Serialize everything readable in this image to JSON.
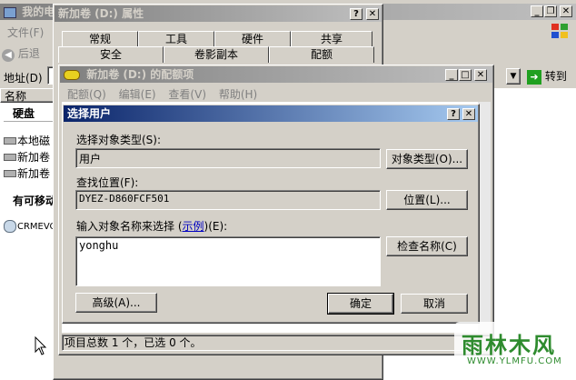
{
  "explorer": {
    "title": "我的电",
    "menu_file": "文件(F)",
    "back": "后退",
    "address_label": "地址(D)",
    "go_label": "转到",
    "column_name": "名称",
    "section_disks": "硬盘",
    "drives": [
      "本地磁",
      "新加卷",
      "新加卷"
    ],
    "section_removable": "有可移动",
    "cd_drive": "CRMEVO"
  },
  "properties": {
    "title": "新加卷 (D:) 属性",
    "tabs_row1": [
      "常规",
      "工具",
      "硬件",
      "共享"
    ],
    "tabs_row2": [
      "安全",
      "卷影副本",
      "配额"
    ]
  },
  "quota": {
    "title": "新加卷 (D:) 的配额项",
    "menu": [
      "配额(Q)",
      "编辑(E)",
      "查看(V)",
      "帮助(H)"
    ],
    "status": "项目总数 1 个，已选 0 个。"
  },
  "select_user": {
    "title": "选择用户",
    "object_type_label": "选择对象类型(S):",
    "object_type_value": "用户",
    "object_type_button": "对象类型(O)...",
    "location_label": "查找位置(F):",
    "location_value": "DYEZ-D860FCF501",
    "location_button": "位置(L)...",
    "names_label_pre": "输入对象名称来选择 (",
    "names_label_link": "示例",
    "names_label_post": ")(E):",
    "names_value": "yonghu",
    "check_names_button": "检查名称(C)",
    "advanced_button": "高级(A)...",
    "ok_button": "确定",
    "cancel_button": "取消"
  },
  "watermark": {
    "text": "雨林木风",
    "url": "WWW.YLMFU.COM"
  }
}
